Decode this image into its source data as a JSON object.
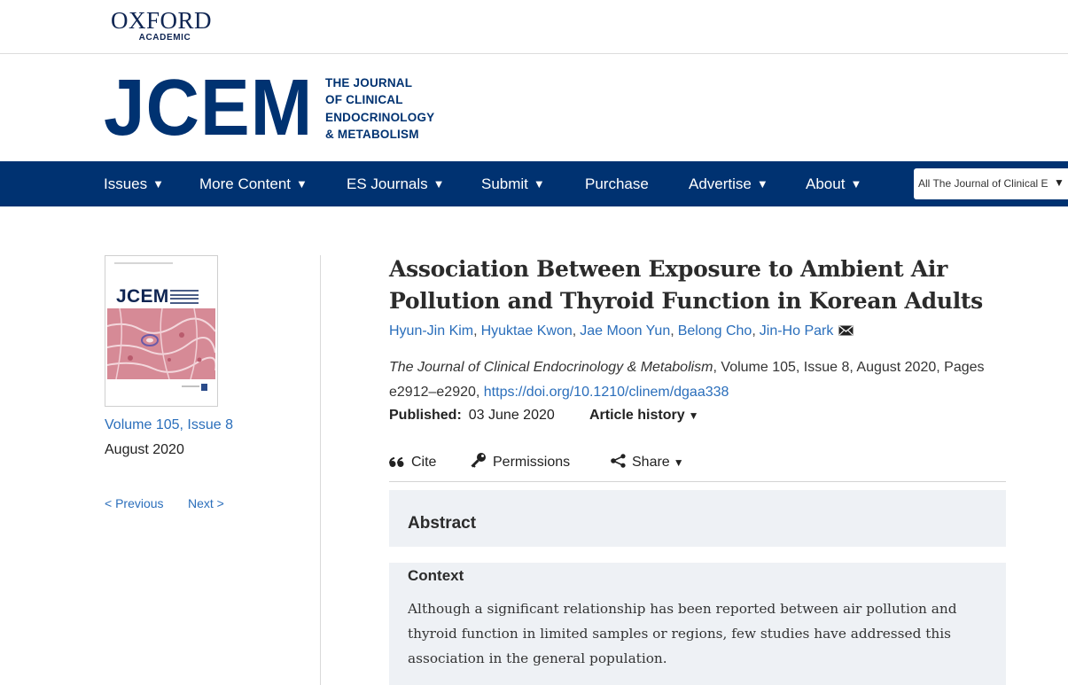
{
  "oxford": {
    "word": "OXFORD",
    "sub": "ACADEMIC"
  },
  "journal": {
    "abbrev": "JCEM",
    "name_lines": [
      "THE JOURNAL",
      "OF CLINICAL",
      "ENDOCRINOLOGY",
      "& METABOLISM"
    ]
  },
  "nav": {
    "items": [
      {
        "label": "Issues",
        "caret": "▼"
      },
      {
        "label": "More Content",
        "caret": "▼"
      },
      {
        "label": "ES Journals",
        "caret": "▼"
      },
      {
        "label": "Submit",
        "caret": "▼"
      },
      {
        "label": "Purchase",
        "caret": ""
      },
      {
        "label": "Advertise",
        "caret": "▼"
      },
      {
        "label": "About",
        "caret": "▼"
      }
    ],
    "search_scope": "All The Journal of Clinical E",
    "search_caret": "▼"
  },
  "issue": {
    "cover_abbrev": "JCEM",
    "link": "Volume 105, Issue 8",
    "date": "August 2020",
    "previous": "< Previous",
    "next": "Next >"
  },
  "article": {
    "title": "Association Between Exposure to Ambient Air Pollution and Thyroid Function in Korean Adults",
    "authors": [
      "Hyun-Jin Kim",
      "Hyuktae Kwon",
      "Jae Moon Yun",
      "Belong Cho",
      "Jin-Ho Park"
    ],
    "author_separator": ",",
    "citation_journal": "The Journal of Clinical Endocrinology & Metabolism",
    "citation_rest": ", Volume 105, Issue 8, August 2020, Pages e2912–e2920, ",
    "doi": "https://doi.org/10.1210/clinem/dgaa338",
    "published_label": "Published:",
    "published_date": "03 June 2020",
    "history_label": "Article history",
    "history_caret": "▼"
  },
  "tools": {
    "cite": "Cite",
    "permissions": "Permissions",
    "share": "Share",
    "share_caret": "▼"
  },
  "abstract": {
    "heading": "Abstract",
    "context_heading": "Context",
    "context_text": "Although a significant relationship has been reported between air pollution and thyroid function in limited samples or regions, few studies have addressed this association in the general population."
  },
  "colors": {
    "brand_navy": "#003271",
    "link_blue": "#2a6ebb",
    "abstract_bg": "#eef1f5"
  },
  "icons": [
    "envelope-icon",
    "quote-icon",
    "key-icon",
    "share-icon",
    "chevron-down-icon"
  ]
}
